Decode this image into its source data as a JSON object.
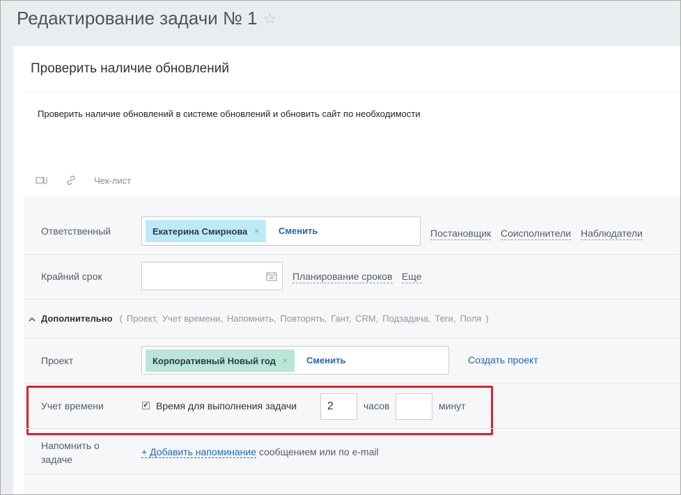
{
  "page": {
    "title": "Редактирование задачи № 1",
    "favorite_icon": "star-icon"
  },
  "task": {
    "title": "Проверить наличие обновлений",
    "description": "Проверить наличие обновлений в системе обновлений и обновить сайт по необходимости",
    "toolbar": {
      "attach_icon": "attach-file-icon",
      "link_icon": "link-icon",
      "checklist_label": "Чек-лист"
    }
  },
  "responsible": {
    "label": "Ответственный",
    "person": "Екатерина Смирнова",
    "remove": "×",
    "change": "Сменить",
    "links": [
      "Постановщик",
      "Соисполнители",
      "Наблюдатели"
    ]
  },
  "deadline": {
    "label": "Крайний срок",
    "value": "",
    "calendar_icon": "calendar-icon",
    "planning_link": "Планирование сроков",
    "more_link": "Еще"
  },
  "extra": {
    "title": "Дополнительно",
    "open_paren": "(",
    "close_paren": ")",
    "items": [
      "Проект,",
      "Учет времени,",
      "Напомнить,",
      "Повторять,",
      "Гант,",
      "CRM,",
      "Подзадача,",
      "Теги,",
      "Поля"
    ]
  },
  "project": {
    "label": "Проект",
    "name": "Корпоративный Новый год",
    "remove": "×",
    "change": "Сменить",
    "create": "Создать проект"
  },
  "time_tracking": {
    "label": "Учет времени",
    "checkbox_checked": true,
    "checkbox_label": "Время для выполнения задачи",
    "hours_value": "2",
    "hours_unit": "часов",
    "minutes_value": "",
    "minutes_unit": "минут"
  },
  "reminder": {
    "label_line1": "Напомнить о",
    "label_line2": "задаче",
    "add_link": "+ Добавить напоминание",
    "suffix": " сообщением или по e-mail"
  },
  "colors": {
    "accent_link": "#2067b0",
    "responsible_tag_bg": "#bdeaf8",
    "project_tag_bg": "#b9e6d9",
    "highlight_border": "#e01f2a"
  }
}
